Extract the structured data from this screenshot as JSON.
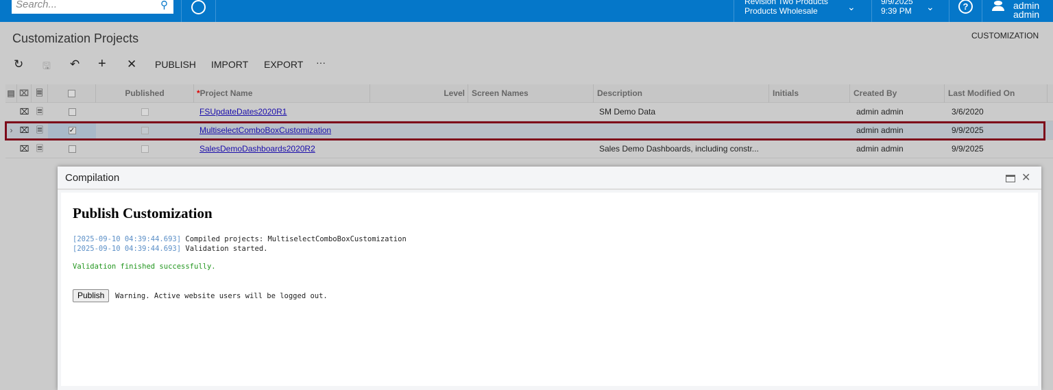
{
  "topbar": {
    "search_placeholder": "Search...",
    "company_line1": "Revision Two Products",
    "company_line2": "Products Wholesale",
    "date": "9/9/2025",
    "time": "9:39 PM",
    "user": "admin admin",
    "brand_color": "#0577c9"
  },
  "page": {
    "title": "Customization Projects",
    "menu_customization": "CUSTOMIZATION"
  },
  "toolbar": {
    "publish": "PUBLISH",
    "import": "IMPORT",
    "export": "EXPORT",
    "more": "···"
  },
  "grid": {
    "headers": {
      "published": "Published",
      "required_mark": "*",
      "project_name": "Project Name",
      "level": "Level",
      "screen_names": "Screen Names",
      "description": "Description",
      "initials": "Initials",
      "created_by": "Created By",
      "last_modified_on": "Last Modified On"
    },
    "rows": [
      {
        "selected": false,
        "published": false,
        "project_name": "FSUpdateDates2020R1",
        "level": "",
        "screen_names": "",
        "description": "SM Demo Data",
        "initials": "",
        "created_by": "admin admin",
        "last_modified_on": "3/6/2020"
      },
      {
        "selected": true,
        "published": false,
        "project_name": "MultiselectComboBoxCustomization",
        "level": "",
        "screen_names": "",
        "description": "",
        "initials": "",
        "created_by": "admin admin",
        "last_modified_on": "9/9/2025"
      },
      {
        "selected": false,
        "published": false,
        "project_name": "SalesDemoDashboards2020R2",
        "level": "",
        "screen_names": "",
        "description": "Sales Demo Dashboards, including constr...",
        "initials": "",
        "created_by": "admin admin",
        "last_modified_on": "9/9/2025"
      }
    ]
  },
  "dialog": {
    "title": "Compilation",
    "heading": "Publish Customization",
    "log": [
      {
        "ts": "[2025-09-10 04:39:44.693]",
        "msg": " Compiled projects: MultiselectComboBoxCustomization"
      },
      {
        "ts": "[2025-09-10 04:39:44.693]",
        "msg": " Validation started."
      }
    ],
    "success": "Validation finished successfully.",
    "publish_button": "Publish",
    "warning": "Warning. Active website users will be logged out."
  }
}
